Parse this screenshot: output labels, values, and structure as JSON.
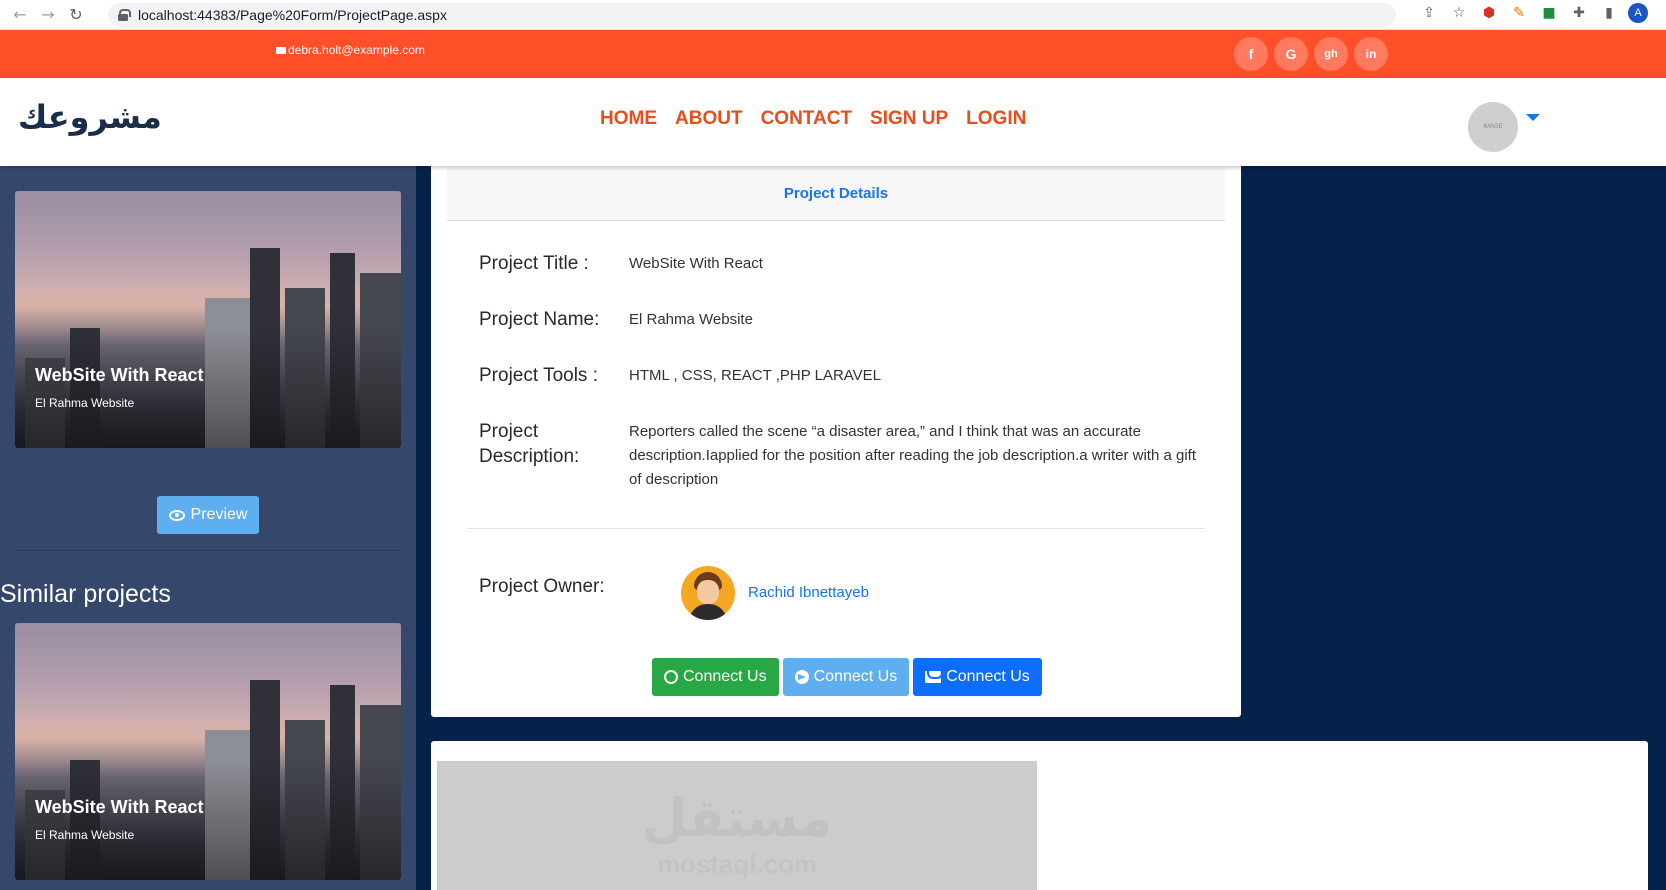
{
  "browser": {
    "url": "localhost:44383/Page%20Form/ProjectPage.aspx",
    "profile_initial": "A"
  },
  "topbar": {
    "email": "debra.holt@example.com",
    "social": [
      "f",
      "G",
      "gh",
      "in"
    ]
  },
  "navbar": {
    "logo_part1": "مشر",
    "logo_part2": "وعك",
    "menu": [
      "HOME",
      "ABOUT",
      "CONTACT",
      "SIGN UP",
      "LOGIN"
    ],
    "avatar_text": "IMAGE"
  },
  "sidebar": {
    "cards": [
      {
        "title": "WebSite With React",
        "subtitle": "El Rahma Website"
      },
      {
        "title": "WebSite With React",
        "subtitle": "El Rahma Website"
      }
    ],
    "preview_label": "Preview",
    "similar_heading": "Similar projects"
  },
  "details": {
    "header": "Project Details",
    "rows": [
      {
        "label": "Project Title :",
        "value": "WebSite With React"
      },
      {
        "label": "Project Name:",
        "value": "El Rahma Website"
      },
      {
        "label": "Project Tools :",
        "value": "HTML , CSS, REACT ,PHP LARAVEL"
      },
      {
        "label": "Project Description:",
        "value": "Reporters called the scene “a disaster area,” and I think that was an accurate description.Iapplied for the position after reading the job description.a writer with a gift of description"
      }
    ],
    "owner_label": "Project Owner:",
    "owner_name": "Rachid Ibnettayeb",
    "buttons": [
      "Connect Us",
      "Connect Us",
      "Connect Us"
    ]
  },
  "bottom": {
    "watermark_ar": "مستقل",
    "watermark_en": "mostaql.com"
  }
}
